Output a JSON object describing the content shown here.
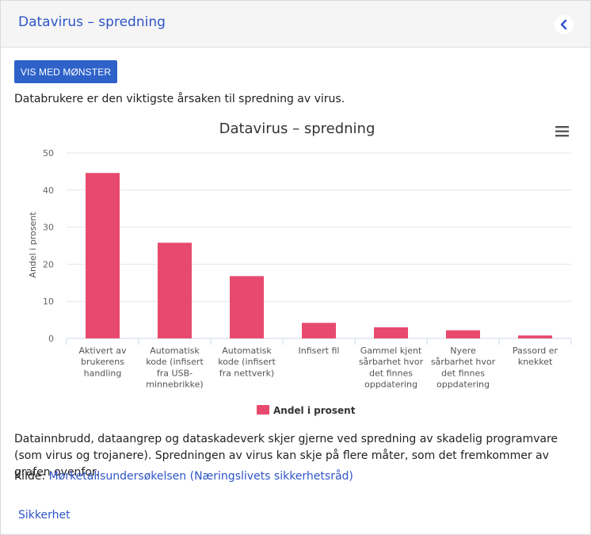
{
  "header": {
    "title": "Datavirus – spredning",
    "collapse_icon": "chevron-left-icon"
  },
  "pattern_button_label": "VIS MED MØNSTER",
  "lead_text": "Databrukere er den viktigste årsaken til spredning av virus.",
  "chart_data": {
    "type": "bar",
    "title": "Datavirus – spredning",
    "ylabel": "Andel i prosent",
    "xlabel": "",
    "ylim": [
      0,
      50
    ],
    "yticks": [
      0,
      10,
      20,
      30,
      40,
      50
    ],
    "grid": true,
    "legend_position": "bottom-center",
    "bar_color": "#e84a6f",
    "categories": [
      [
        "Aktivert av",
        "brukerens",
        "handling"
      ],
      [
        "Automatisk",
        "kode (infisert",
        "fra USB-",
        "minnebrikke)"
      ],
      [
        "Automatisk",
        "kode (infisert",
        "fra nettverk)"
      ],
      [
        "Infisert fil"
      ],
      [
        "Gammel kjent",
        "sårbarhet hvor",
        "det finnes",
        "oppdatering"
      ],
      [
        "Nyere",
        "sårbarhet hvor",
        "det finnes",
        "oppdatering"
      ],
      [
        "Passord er",
        "knekket"
      ]
    ],
    "series": [
      {
        "name": "Andel i prosent",
        "values": [
          44.6,
          25.8,
          16.8,
          4.2,
          3.0,
          2.2,
          0.8
        ]
      }
    ],
    "menu_icon": "hamburger-menu-icon"
  },
  "body_text": "Datainnbrudd, dataangrep og dataskadeverk skjer gjerne ved spredning av skadelig programvare (som virus og trojanere). Spredningen av virus kan skje på flere måter, som det fremkommer av grafen ovenfor.",
  "source": {
    "prefix": "Kilde: ",
    "link_text": "Mørketallsundersøkelsen (Næringslivets sikkerhetsråd)"
  },
  "tag_link": "Sikkerhet"
}
